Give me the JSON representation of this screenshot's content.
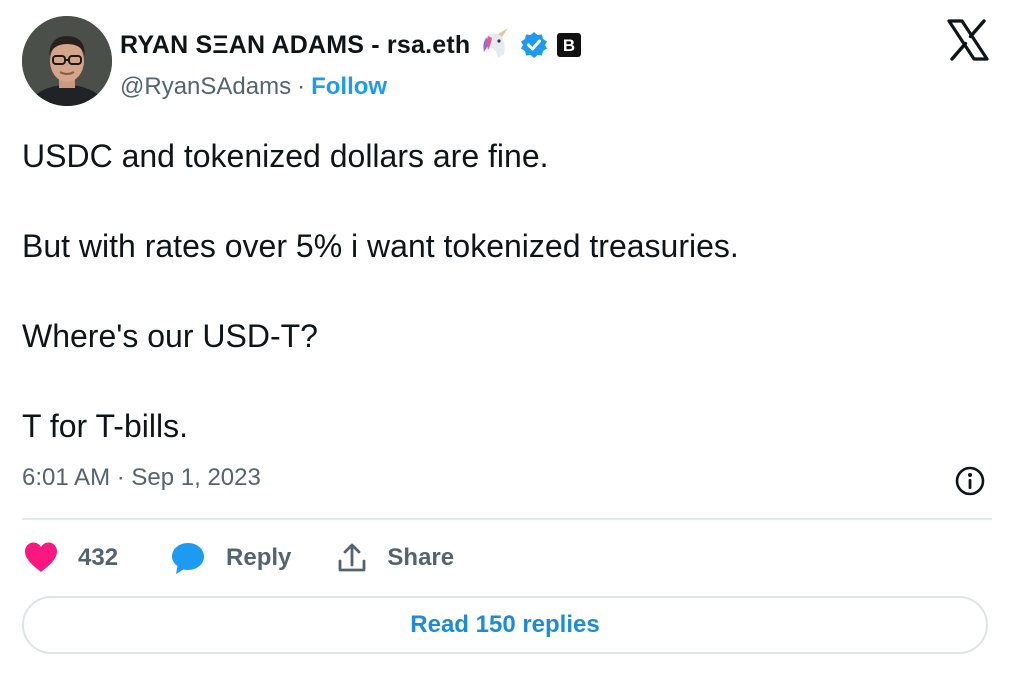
{
  "author": {
    "display_name": "RYAN SΞAN ADAMS - rsa.eth",
    "handle": "@RyanSAdams",
    "separator": "·",
    "follow_label": "Follow",
    "badges": [
      "unicorn-emoji",
      "verified-badge",
      "bankless-badge"
    ],
    "badge_letter": "B"
  },
  "platform": {
    "logo": "x-logo"
  },
  "tweet": {
    "paragraphs": [
      "USDC and tokenized dollars are fine.",
      "But with rates over 5% i want tokenized treasuries.",
      "Where's our USD-T?",
      "T for T-bills."
    ],
    "timestamp": "6:01 AM · Sep 1, 2023"
  },
  "actions": {
    "like_count": "432",
    "reply_label": "Reply",
    "share_label": "Share"
  },
  "read_replies_label": "Read 150 replies",
  "colors": {
    "accent": "#1d9bf0",
    "heart": "#f91880",
    "verified": "#1d9bf0",
    "muted_text": "#536471"
  }
}
